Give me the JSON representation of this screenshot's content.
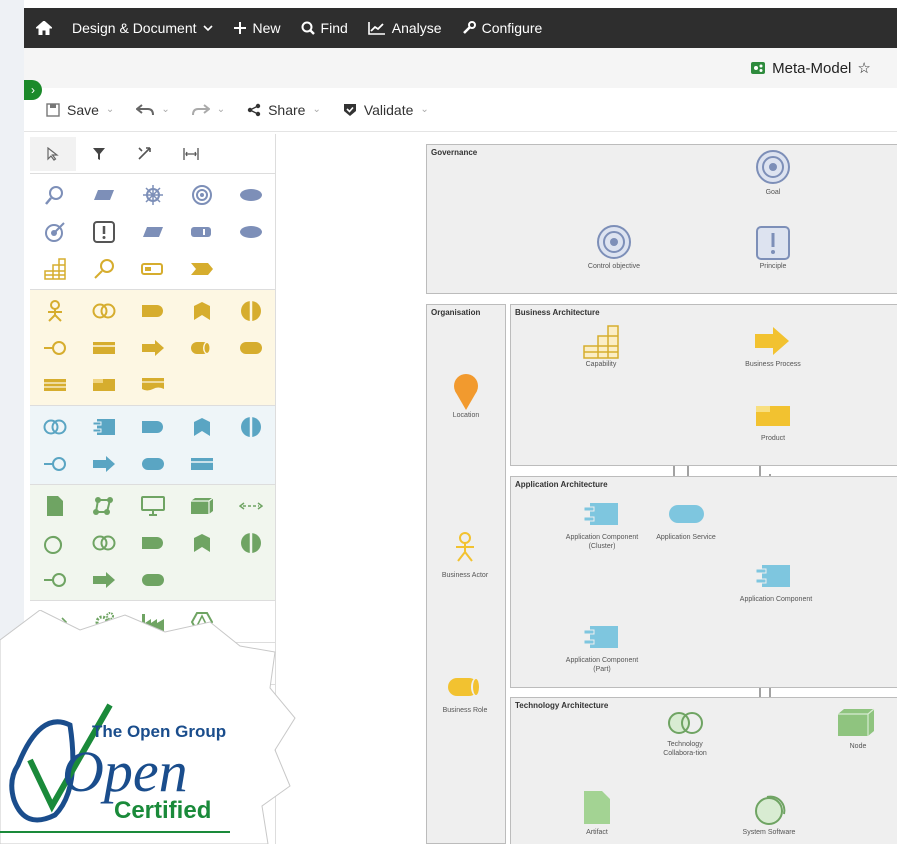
{
  "topbar": {
    "home_icon": "home-icon",
    "menus": [
      {
        "label": "Design & Document",
        "icon": "chevron-down-icon"
      },
      {
        "label": "New",
        "icon": "plus-icon"
      },
      {
        "label": "Find",
        "icon": "search-icon"
      },
      {
        "label": "Analyse",
        "icon": "chart-line-icon"
      },
      {
        "label": "Configure",
        "icon": "wrench-icon"
      }
    ]
  },
  "title": {
    "name": "Meta-Model",
    "star": "☆"
  },
  "toolbar": {
    "save": "Save",
    "share": "Share",
    "validate": "Validate"
  },
  "canvas": {
    "lanes": {
      "governance": "Governance",
      "organisation": "Organisation",
      "business": "Business Architecture",
      "application": "Application Architecture",
      "technology": "Technology Architecture"
    },
    "nodes": {
      "goal": "Goal",
      "control_objective": "Control objective",
      "principle": "Principle",
      "location": "Location",
      "capability": "Capability",
      "business_process": "Business Process",
      "product": "Product",
      "business_actor": "Business Actor",
      "app_component_cluster": "Application Component (Cluster)",
      "app_service": "Application Service",
      "app_component": "Application Component",
      "app_component_part": "Application Component (Part)",
      "business_role": "Business Role",
      "tech_collab": "Technology Collabora-tion",
      "node": "Node",
      "artifact": "Artifact",
      "system_software": "System Software"
    }
  },
  "badge": {
    "org": "The Open Group",
    "word": "Open",
    "certified": "Certified"
  },
  "colors": {
    "governance": "#7d8fb8",
    "business": "#d6ad2e",
    "application": "#5aa5c3",
    "technology": "#6fa463",
    "location": "#f29a2e"
  }
}
